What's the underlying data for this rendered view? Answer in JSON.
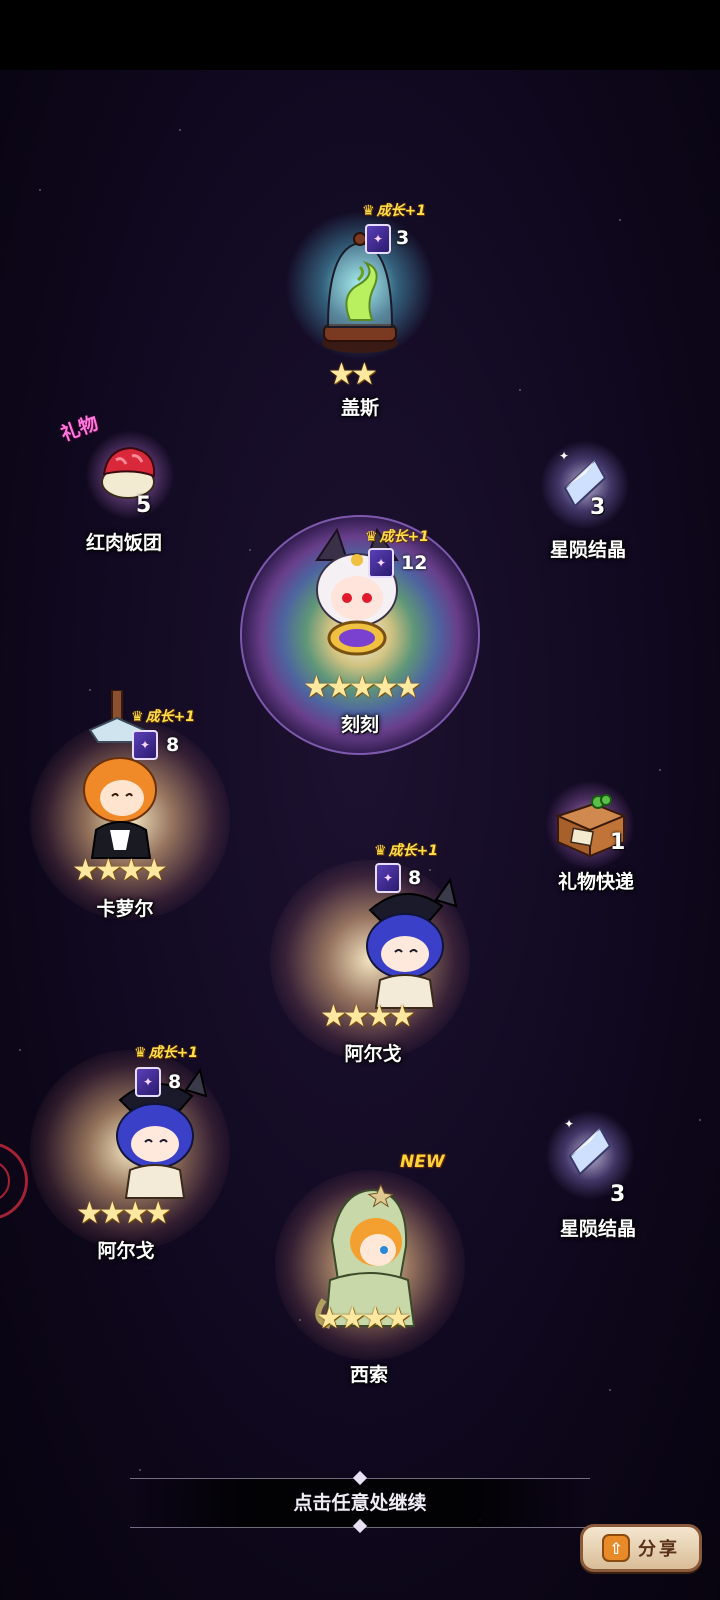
{
  "continue_hint": "点击任意处继续",
  "share_label": "分享",
  "gift_tag": "礼物",
  "new_badge": "NEW",
  "growth_label": "成长+1",
  "items": {
    "gaisi": {
      "name": "盖斯",
      "card_count": "3",
      "stars": 2
    },
    "kekke": {
      "name": "刻刻",
      "card_count": "12",
      "stars": 5
    },
    "kaluoer": {
      "name": "卡萝尔",
      "card_count": "8",
      "stars": 4
    },
    "aerge_1": {
      "name": "阿尔戈",
      "card_count": "8",
      "stars": 4
    },
    "aerge_2": {
      "name": "阿尔戈",
      "card_count": "8",
      "stars": 4
    },
    "xisuo": {
      "name": "西索",
      "stars": 4
    },
    "rice_ball": {
      "name": "红肉饭团",
      "count": "5"
    },
    "star_crystal_1": {
      "name": "星陨结晶",
      "count": "3"
    },
    "star_crystal_2": {
      "name": "星陨结晶",
      "count": "3"
    },
    "gift_express": {
      "name": "礼物快递",
      "count": "1"
    }
  },
  "colors": {
    "growth": "#ffe04a",
    "gift_tag": "#ff7ae0",
    "new": "#ffd23a",
    "share_button": "#e68a2a"
  }
}
